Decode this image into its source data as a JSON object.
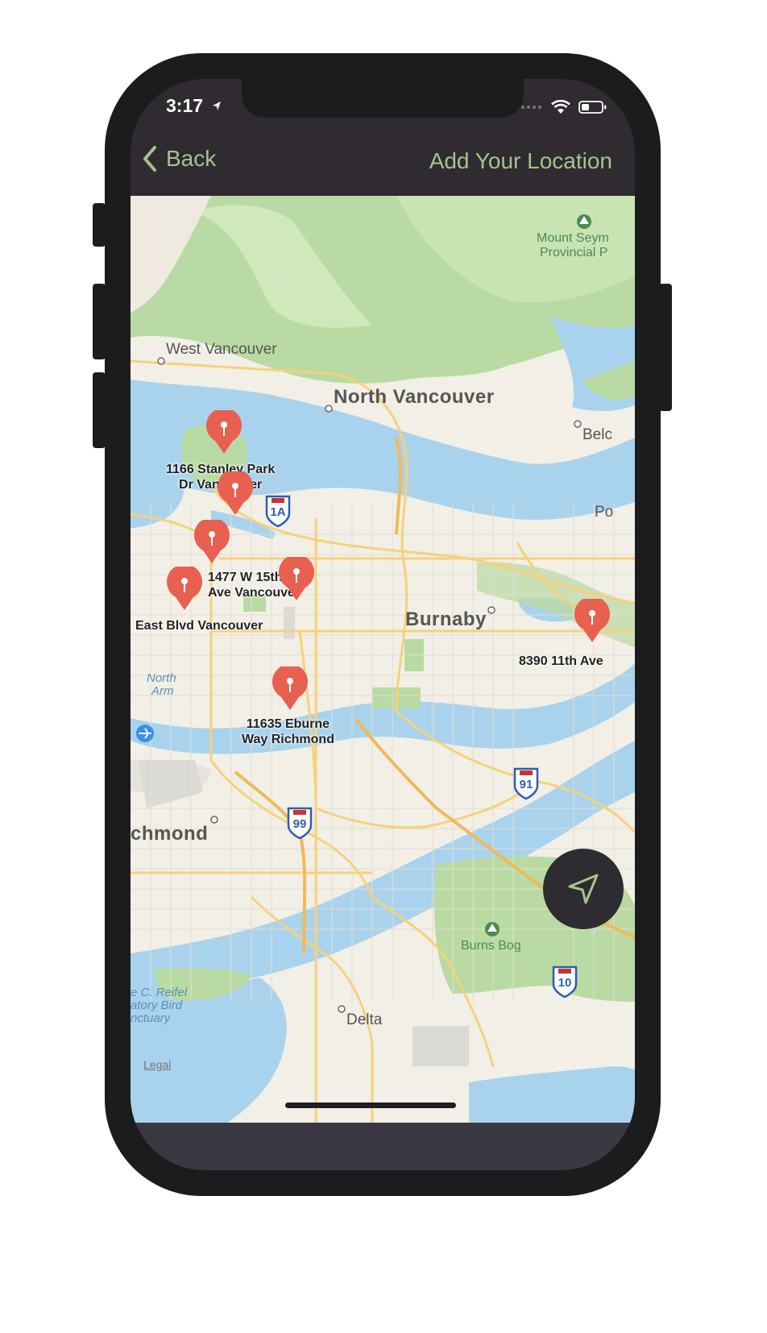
{
  "status_bar": {
    "time": "3:17"
  },
  "nav": {
    "back_label": "Back",
    "title": "Add Your Location"
  },
  "map": {
    "places": {
      "west_vancouver": "West Vancouver",
      "north_vancouver": "North Vancouver",
      "burnaby": "Burnaby",
      "richmond": "chmond",
      "delta": "Delta",
      "belc": "Belc",
      "po": "Po",
      "mount_seymour_1": "Mount Seym",
      "mount_seymour_2": "Provincial P",
      "burns_bog": "Burns Bog",
      "north_arm_1": "North",
      "north_arm_2": "Arm",
      "reifel_1": "e C. Reifel",
      "reifel_2": "atory Bird",
      "reifel_3": "nctuary"
    },
    "pins": [
      {
        "label_1": "1166 Stanley Park",
        "label_2": "Dr Vancouver"
      },
      {
        "label_1": "",
        "label_2": ""
      },
      {
        "label_1": "1477 W 15th",
        "label_2": "Ave Vancouver"
      },
      {
        "label_1": "",
        "label_2": ""
      },
      {
        "label_1": "East Blvd Vancouver",
        "label_2": ""
      },
      {
        "label_1": "11635 Eburne",
        "label_2": "Way Richmond"
      },
      {
        "label_1": "8390 11th Ave",
        "label_2": ""
      }
    ],
    "highways": [
      "1A",
      "91",
      "99",
      "10"
    ],
    "legal_label": "Legal"
  },
  "colors": {
    "accent": "#a3c58d",
    "pin": "#e8604f",
    "water": "#a9d3ec",
    "park": "#b9dba3"
  },
  "icons": {
    "back": "chevron-left-icon",
    "locate": "navigation-arrow-icon",
    "pin": "map-pin-icon"
  }
}
